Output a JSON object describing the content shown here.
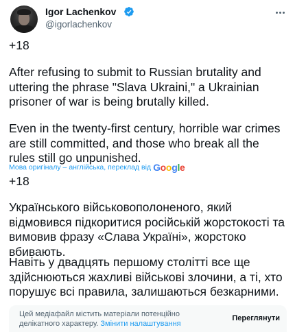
{
  "author": {
    "name": "Igor Lachenkov",
    "handle": "@igorlachenkov",
    "avatar_icon": "profile-photo",
    "verified_icon": "verified-badge-icon",
    "verified_color": "#1d9bf0"
  },
  "tweet": {
    "count_label_1": "+18",
    "paragraph_1": "After refusing to submit to Russian brutality and uttering the phrase \"Slava Ukraini,\" a Ukrainian prisoner of war is being brutally killed.",
    "paragraph_2": "Even in the twenty-first century, horrible war crimes are still committed, and those who break all the rules still go unpunished.",
    "translation_note": "Мова оригіналу – англійська, переклад від",
    "translation_provider": "Google",
    "count_label_2": "+18",
    "paragraph_3": "Українського військовополоненого, який відмовився підкоритися російській жорстокості та вимовив фразу «Слава Україні», жорстоко вбивають.",
    "paragraph_4": "Навіть у двадцять першому столітті все ще здійснюються жахливі військові злочини, а ті, хто порушує всі правила, залишаються безкарними."
  },
  "sensitive_media": {
    "message": "Цей медіафайл містить матеріали потенційно делікатного характеру.",
    "change_settings_link": "Змінити налаштування",
    "view_button": "Переглянути"
  },
  "colors": {
    "link": "#1d9bf0",
    "secondary_text": "#536471",
    "primary_text": "#0f1419",
    "warning_bg": "#f7f9f9"
  }
}
